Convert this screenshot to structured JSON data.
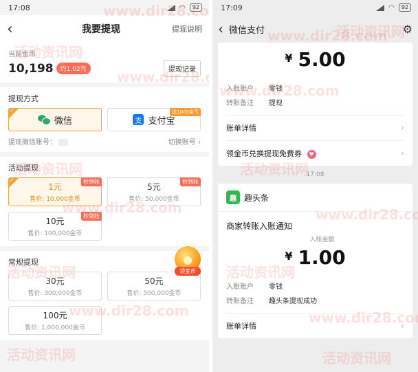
{
  "left": {
    "status": {
      "time": "17:08",
      "battery": "92"
    },
    "header": {
      "title": "我要提现",
      "help": "提现说明",
      "back_glyph": "‹"
    },
    "coins": {
      "label": "当前金币",
      "value": "10,198",
      "approx": "约1.02元",
      "records_button": "提现记录"
    },
    "methods": {
      "title": "提现方式",
      "options": [
        {
          "label": "微信",
          "icon": "wechat-icon",
          "selected": true
        },
        {
          "label": "支付宝",
          "icon": "alipay-icon",
          "icon_text": "支",
          "promo": "送1000金币",
          "selected": false
        }
      ],
      "account_label": "提现微信账号：",
      "switch_label": "切换账号 ›"
    },
    "activity": {
      "title": "活动提现",
      "options": [
        {
          "amount": "1元",
          "price": "售价: 10,000金币",
          "tag": "秒到账",
          "selected": true
        },
        {
          "amount": "5元",
          "price": "售价: 50,000金币",
          "tag": "秒到账",
          "selected": false
        },
        {
          "amount": "10元",
          "price": "售价: 100,000金币",
          "tag": "秒到账",
          "selected": false
        }
      ]
    },
    "regular": {
      "title": "常规提现",
      "options": [
        {
          "amount": "30元",
          "price": "售价: 300,000金币"
        },
        {
          "amount": "50元",
          "price": "售价: 500,000金币"
        },
        {
          "amount": "100元",
          "price": "售价: 1,000,000金币"
        }
      ]
    },
    "coin_badge": {
      "label": "领金币"
    }
  },
  "right": {
    "status": {
      "time": "17:09",
      "battery": "92"
    },
    "header": {
      "title": "微信支付",
      "back_glyph": "‹"
    },
    "payment1": {
      "currency": "¥",
      "amount": "5.00",
      "rows": [
        {
          "k": "入账账户",
          "v": "零钱"
        },
        {
          "k": "转账备注",
          "v": "提现"
        }
      ],
      "detail_label": "账单详情",
      "coupon_label": "领金币兑换提现免费券"
    },
    "time_divider": "17:08",
    "payment2": {
      "merchant": "趣头条",
      "merchant_icon_text": "趣",
      "notice": "商家转账入账通知",
      "amount_label": "入账金额",
      "currency": "¥",
      "amount": "1.00",
      "rows": [
        {
          "k": "入账账户",
          "v": "零钱"
        },
        {
          "k": "转账备注",
          "v": "趣头条提现成功"
        }
      ],
      "detail_label": "账单详情"
    }
  },
  "watermarks": [
    "www.dir28.com",
    "活动资讯网"
  ],
  "colors": {
    "accent_orange": "#f2a33a",
    "wechat_green": "#2aae67",
    "alipay_blue": "#1677ff",
    "tag_red": "#ff6b52"
  }
}
